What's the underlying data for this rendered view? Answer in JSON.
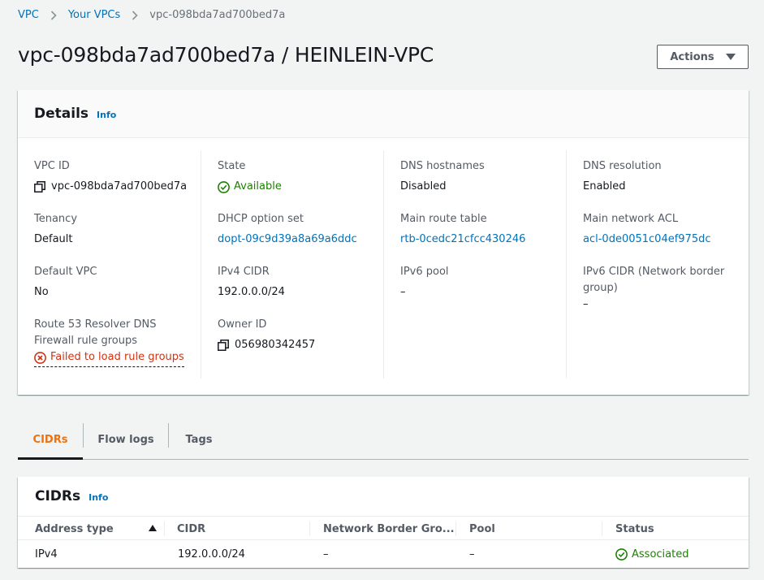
{
  "breadcrumb": {
    "items": [
      "VPC",
      "Your VPCs",
      "vpc-098bda7ad700bed7a"
    ]
  },
  "header": {
    "title": "vpc-098bda7ad700bed7a / HEINLEIN-VPC",
    "actions_label": "Actions"
  },
  "details": {
    "title": "Details",
    "info": "Info",
    "fields": {
      "vpc_id": {
        "label": "VPC ID",
        "value": "vpc-098bda7ad700bed7a"
      },
      "tenancy": {
        "label": "Tenancy",
        "value": "Default"
      },
      "default_vpc": {
        "label": "Default VPC",
        "value": "No"
      },
      "route53": {
        "label": "Route 53 Resolver DNS Firewall rule groups",
        "value": "Failed to load rule groups"
      },
      "state": {
        "label": "State",
        "value": "Available"
      },
      "dhcp": {
        "label": "DHCP option set",
        "value": "dopt-09c9d39a8a69a6ddc"
      },
      "ipv4_cidr": {
        "label": "IPv4 CIDR",
        "value": "192.0.0.0/24"
      },
      "owner_id": {
        "label": "Owner ID",
        "value": "056980342457"
      },
      "dns_hostnames": {
        "label": "DNS hostnames",
        "value": "Disabled"
      },
      "main_route_table": {
        "label": "Main route table",
        "value": "rtb-0cedc21cfcc430246"
      },
      "ipv6_pool": {
        "label": "IPv6 pool",
        "value": "–"
      },
      "dns_resolution": {
        "label": "DNS resolution",
        "value": "Enabled"
      },
      "main_network_acl": {
        "label": "Main network ACL",
        "value": "acl-0de0051c04ef975dc"
      },
      "ipv6_cidr": {
        "label": "IPv6 CIDR (Network border group)",
        "value": "–"
      }
    }
  },
  "tabs": [
    "CIDRs",
    "Flow logs",
    "Tags"
  ],
  "cidrs": {
    "title": "CIDRs",
    "info": "Info",
    "columns": [
      "Address type",
      "CIDR",
      "Network Border Gro...",
      "Pool",
      "Status"
    ],
    "rows": [
      {
        "address_type": "IPv4",
        "cidr": "192.0.0.0/24",
        "nbg": "–",
        "pool": "–",
        "status": "Associated"
      }
    ]
  },
  "colors": {
    "link": "#0073bb",
    "success": "#1d8102",
    "error": "#d13212",
    "active_tab": "#ec7211"
  }
}
